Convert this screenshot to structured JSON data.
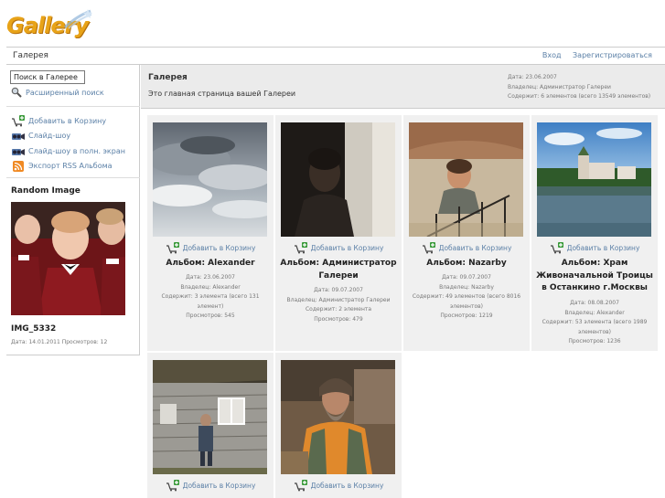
{
  "logo": {
    "text": "Gallery"
  },
  "breadcrumb": {
    "current": "Галерея"
  },
  "auth": {
    "login": "Вход",
    "register": "Зарегистрироваться"
  },
  "sidebar": {
    "search": {
      "value": "Поиск в Галерее"
    },
    "advanced_search": "Расширенный поиск",
    "menu": [
      {
        "label": "Добавить в Корзину",
        "icon": "cart-add-icon"
      },
      {
        "label": "Слайд-шоу",
        "icon": "slideshow-icon"
      },
      {
        "label": "Слайд-шоу в полн. экран",
        "icon": "fullscreen-slideshow-icon"
      },
      {
        "label": "Экспорт RSS Альбома",
        "icon": "rss-icon"
      }
    ],
    "random": {
      "title": "Random Image",
      "name": "IMG_5332",
      "meta": "Дата: 14.01.2011 Просмотров: 12"
    }
  },
  "gallery": {
    "title": "Галерея",
    "description": "Это главная страница вашей Галереи",
    "info": [
      "Дата: 23.06.2007",
      "Владелец: Администратор Галереи",
      "Содержит: 6 элементов (всего 13549 элементов)"
    ]
  },
  "cart_label": "Добавить в Корзину",
  "albums": [
    {
      "title": "Альбом: Alexander",
      "meta": [
        "Дата: 23.06.2007",
        "Владелец: Alexander",
        "Содержит: 3 элемента (всего 131 элемент)",
        "Просмотров: 545"
      ]
    },
    {
      "title": "Альбом: Администратор Галереи",
      "meta": [
        "Дата: 09.07.2007",
        "Владелец: Администратор Галереи",
        "Содержит: 2 элемента",
        "Просмотров: 479"
      ]
    },
    {
      "title": "Альбом: Nazarby",
      "meta": [
        "Дата: 09.07.2007",
        "Владелец: Nazarby",
        "Содержит: 49 элементов (всего 8016 элементов)",
        "Просмотров: 1219"
      ]
    },
    {
      "title": "Альбом: Храм Живоначальной Троицы в Останкино г.Москвы",
      "meta": [
        "Дата: 08.08.2007",
        "Владелец: Alexander",
        "Содержит: 53 элемента (всего 1989 элементов)",
        "Просмотров: 1236"
      ]
    },
    {
      "title": "",
      "meta": []
    },
    {
      "title": "",
      "meta": []
    }
  ]
}
